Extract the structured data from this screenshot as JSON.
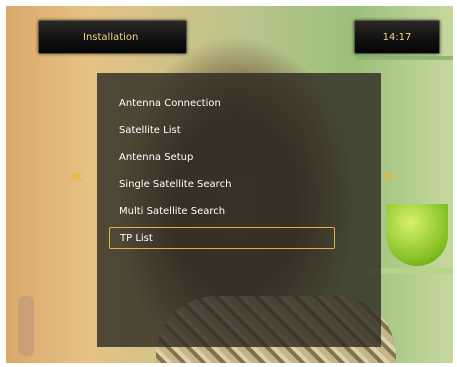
{
  "header": {
    "title": "Installation",
    "time": "14:17"
  },
  "menu": {
    "items": [
      {
        "label": "Antenna Connection"
      },
      {
        "label": "Satellite List"
      },
      {
        "label": "Antenna Setup"
      },
      {
        "label": "Single Satellite Search"
      },
      {
        "label": "Multi Satellite Search"
      },
      {
        "label": "TP List",
        "selected": true
      }
    ]
  },
  "nav": {
    "left_arrow": "«",
    "right_arrow": "»"
  },
  "colors": {
    "accent": "#e2b43e",
    "header_text": "#f5d58a",
    "menu_text": "#ffffff"
  },
  "icons": [
    "chevron-double-left-icon",
    "chevron-double-right-icon"
  ]
}
